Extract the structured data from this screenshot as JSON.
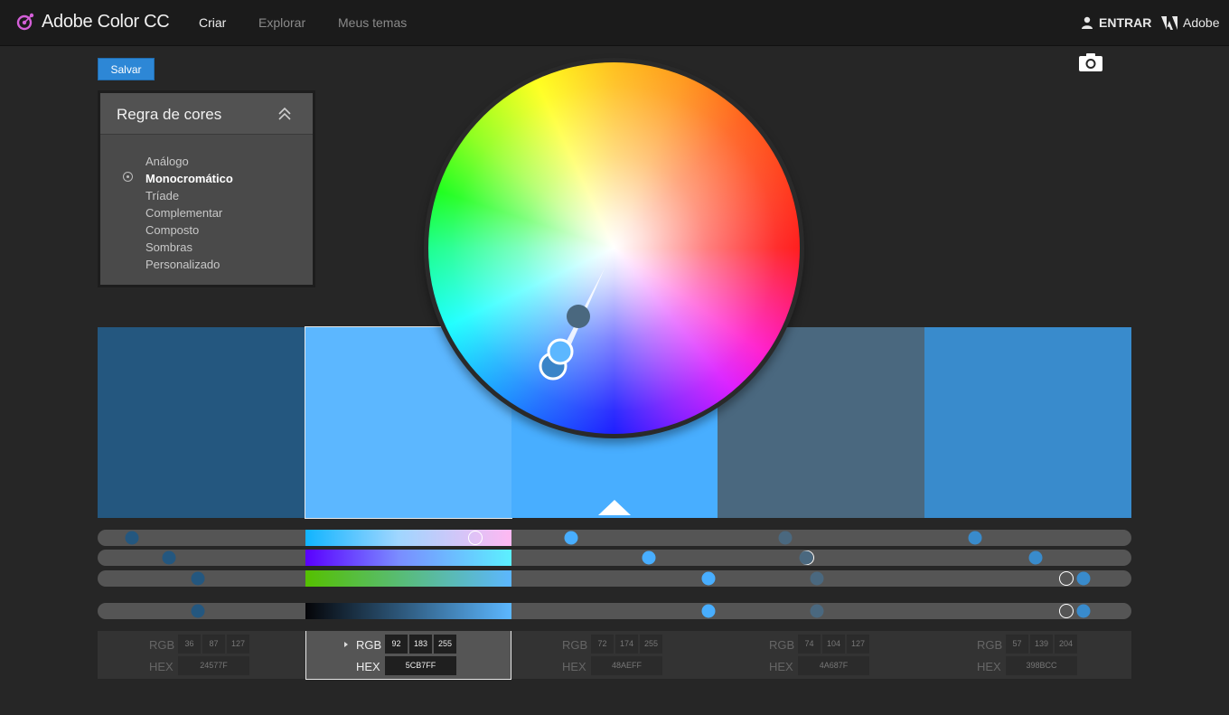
{
  "app": {
    "title": "Adobe Color CC"
  },
  "nav": {
    "items": [
      "Criar",
      "Explorar",
      "Meus temas"
    ],
    "active": "Criar"
  },
  "header": {
    "signin_label": "ENTRAR",
    "adobe_label": "Adobe"
  },
  "toolbar": {
    "save_label": "Salvar",
    "camera_icon": "camera-icon"
  },
  "rule_panel": {
    "title": "Regra de cores",
    "items": [
      "Análogo",
      "Monocromático",
      "Tríade",
      "Complementar",
      "Composto",
      "Sombras",
      "Personalizado"
    ],
    "selected": "Monocromático"
  },
  "swatches": [
    {
      "rgb": [
        "36",
        "87",
        "127"
      ],
      "hex": "24577F",
      "color": "#24577f"
    },
    {
      "rgb": [
        "92",
        "183",
        "255"
      ],
      "hex": "5CB7FF",
      "color": "#5cb7ff"
    },
    {
      "rgb": [
        "72",
        "174",
        "255"
      ],
      "hex": "48AEFF",
      "color": "#48aeff"
    },
    {
      "rgb": [
        "74",
        "104",
        "127"
      ],
      "hex": "4A687F",
      "color": "#4a687f"
    },
    {
      "rgb": [
        "57",
        "139",
        "204"
      ],
      "hex": "398BCC",
      "color": "#398bcc"
    }
  ],
  "selected_swatch": 1,
  "sliders": [
    [
      0.033,
      0.365,
      0.458,
      0.665,
      0.849
    ],
    [
      0.069,
      0.686,
      0.533,
      0.685,
      0.907
    ],
    [
      0.097,
      0.937,
      0.591,
      0.696,
      0.954
    ],
    [
      0.097,
      0.937,
      0.591,
      0.696,
      0.954
    ]
  ],
  "labels": {
    "rgb": "RGB",
    "hex": "HEX"
  }
}
